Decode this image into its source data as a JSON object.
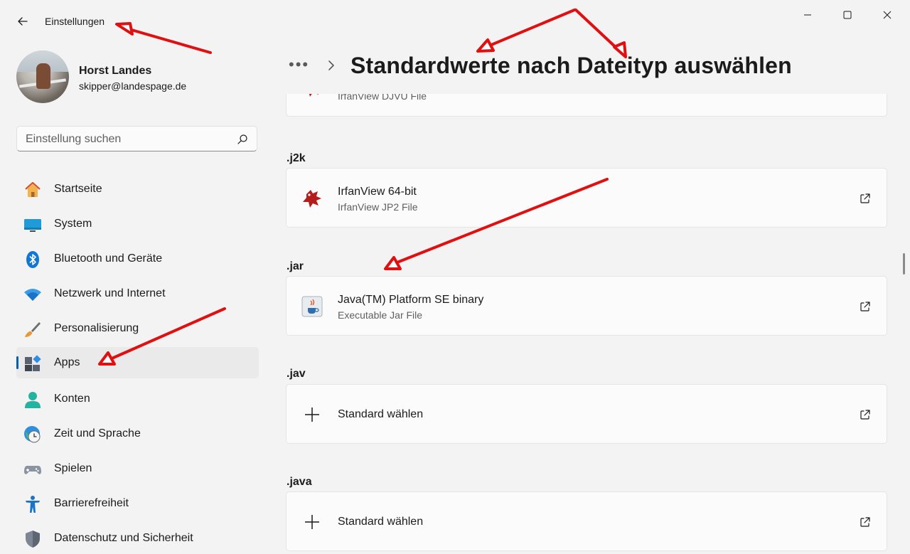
{
  "window": {
    "title": "Einstellungen",
    "controls": {
      "minimize": "minimize-icon",
      "maximize": "maximize-icon",
      "close": "close-icon"
    }
  },
  "profile": {
    "name": "Horst Landes",
    "email": "skipper@landespage.de"
  },
  "search": {
    "placeholder": "Einstellung suchen"
  },
  "sidebar": {
    "items": [
      {
        "label": "Startseite",
        "icon": "home-icon"
      },
      {
        "label": "System",
        "icon": "monitor-icon"
      },
      {
        "label": "Bluetooth und Geräte",
        "icon": "bluetooth-icon"
      },
      {
        "label": "Netzwerk und Internet",
        "icon": "wifi-icon"
      },
      {
        "label": "Personalisierung",
        "icon": "brush-icon"
      },
      {
        "label": "Apps",
        "icon": "apps-icon",
        "selected": true
      },
      {
        "label": "Konten",
        "icon": "person-icon"
      },
      {
        "label": "Zeit und Sprache",
        "icon": "clock-icon"
      },
      {
        "label": "Spielen",
        "icon": "gamepad-icon"
      },
      {
        "label": "Barrierefreiheit",
        "icon": "accessibility-icon"
      },
      {
        "label": "Datenschutz und Sicherheit",
        "icon": "shield-icon"
      }
    ]
  },
  "header": {
    "breadcrumb_overflow": "•••",
    "title": "Standardwerte nach Dateityp auswählen"
  },
  "file_types": [
    {
      "ext": "",
      "app_name": "",
      "app_desc": "IrfanView DJVU File",
      "icon": "irfanview-icon"
    },
    {
      "ext": ".j2k",
      "app_name": "IrfanView 64-bit",
      "app_desc": "IrfanView JP2 File",
      "icon": "irfanview-icon"
    },
    {
      "ext": ".jar",
      "app_name": "Java(TM) Platform SE binary",
      "app_desc": "Executable Jar File",
      "icon": "java-icon"
    },
    {
      "ext": ".jav",
      "choose_label": "Standard wählen",
      "icon": "plus-icon"
    },
    {
      "ext": ".java",
      "choose_label": "Standard wählen",
      "icon": "plus-icon"
    }
  ],
  "colors": {
    "accent": "#005fb8",
    "background": "#f3f3f3",
    "card": "#fbfbfb",
    "annotation": "#e01010"
  }
}
